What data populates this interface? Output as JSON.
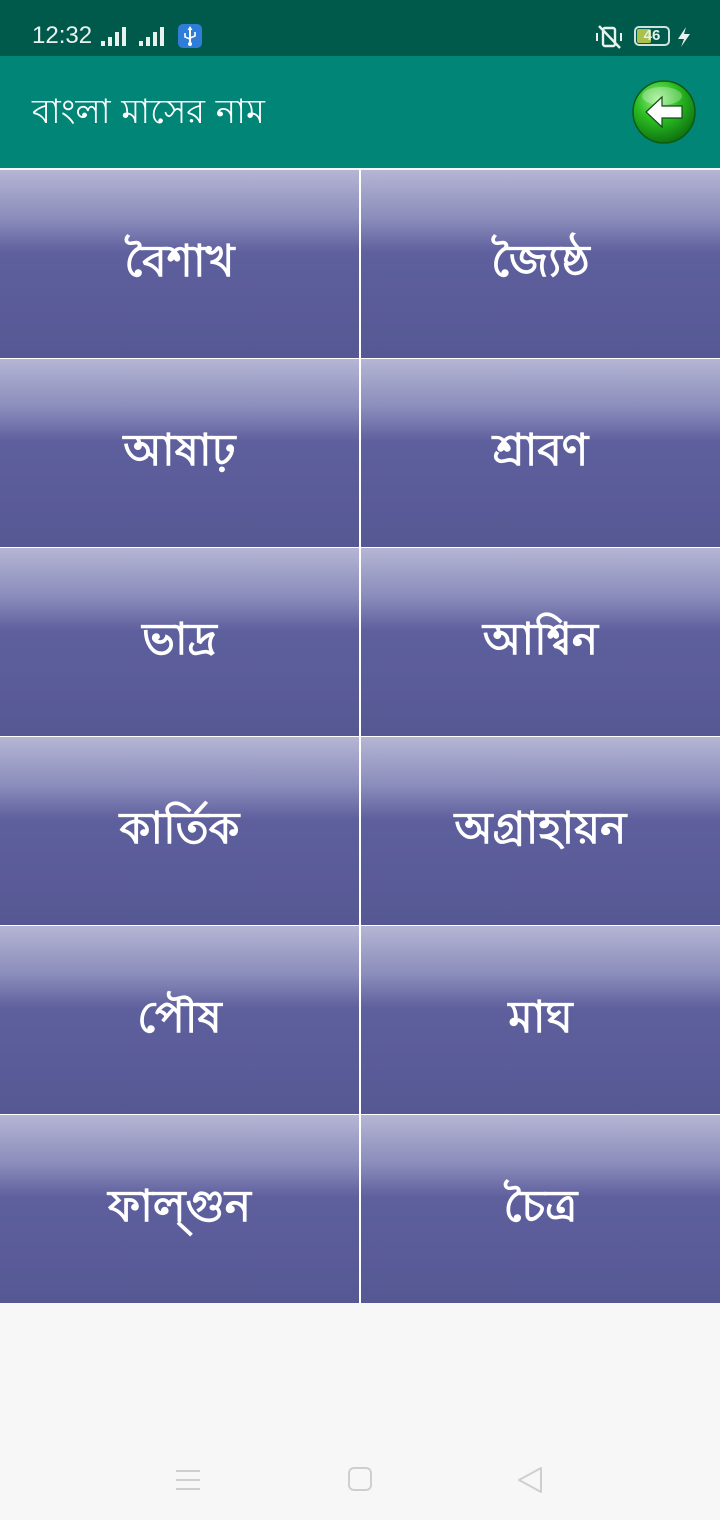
{
  "status_bar": {
    "time": "12:32",
    "battery_level": "46",
    "battery_fraction": 0.46,
    "icons": [
      "signal-icon",
      "signal-icon",
      "usb-icon",
      "vibrate-mute-icon",
      "battery-icon",
      "charging-bolt-icon"
    ]
  },
  "app_bar": {
    "title": "বাংলা মাসের নাম",
    "back_icon": "back-arrow-icon",
    "color": "#008577"
  },
  "months": [
    {
      "label": "বৈশাখ"
    },
    {
      "label": "জ্যৈষ্ঠ"
    },
    {
      "label": "আষাঢ়"
    },
    {
      "label": "শ্রাবণ"
    },
    {
      "label": "ভাদ্র"
    },
    {
      "label": "আশ্বিন"
    },
    {
      "label": "কার্তিক"
    },
    {
      "label": "অগ্রাহায়ন"
    },
    {
      "label": "পৌষ"
    },
    {
      "label": "মাঘ"
    },
    {
      "label": "ফাল্গুন"
    },
    {
      "label": "চৈত্র"
    }
  ],
  "theme": {
    "status_bar": "#005a4c",
    "tile_top": "#b5b5d4",
    "tile_bottom": "#565894",
    "back_button": "#1fae1f"
  },
  "nav_bar": {
    "icons": [
      "menu-icon",
      "home-icon",
      "back-triangle-icon"
    ]
  }
}
